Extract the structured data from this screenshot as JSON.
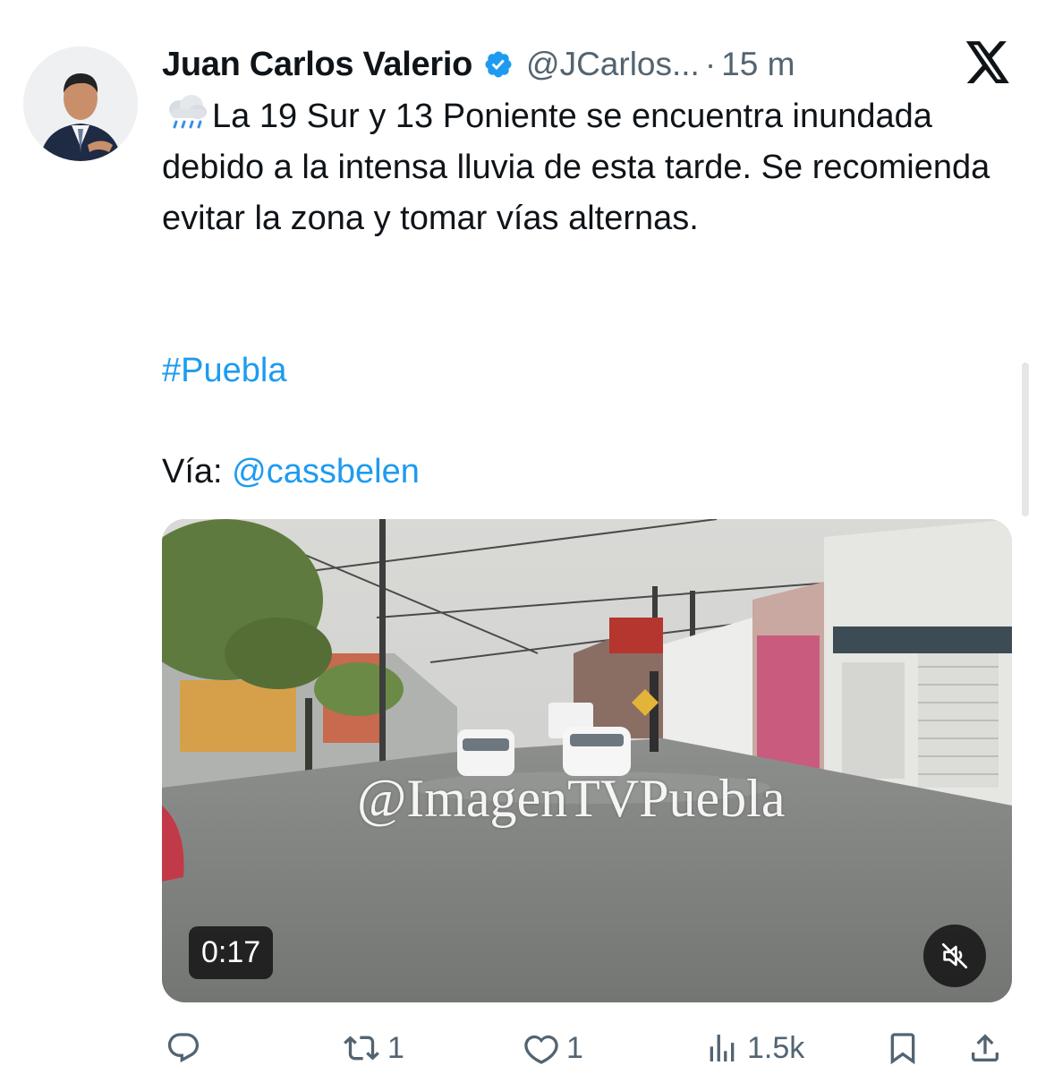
{
  "tweet": {
    "author_name": "Juan Carlos Valerio",
    "handle": "@JCarlos...",
    "separator": "·",
    "time": "15 m",
    "text": "La 19 Sur y 13 Poniente se encuentra inundada debido a la intensa lluvia de esta tarde. Se recomienda evitar la zona y tomar vías alternas.",
    "hashtag": "#Puebla",
    "via_label": "Vía:",
    "via_mention": "@cassbelen"
  },
  "media": {
    "watermark": "@ImagenTVPuebla",
    "duration": "0:17"
  },
  "actions": {
    "replies": "",
    "retweets": "1",
    "likes": "1",
    "views": "1.5k"
  },
  "icons": {
    "emoji": "cloud-with-rain-icon",
    "verified": "verified-badge-icon",
    "logo": "x-logo-icon",
    "mute": "muted-speaker-icon",
    "reply": "reply-icon",
    "retweet": "retweet-icon",
    "like": "heart-icon",
    "views": "views-icon",
    "bookmark": "bookmark-icon",
    "share": "share-icon"
  },
  "colors": {
    "link": "#1d9bf0",
    "text": "#0f1419",
    "secondary": "#536471"
  }
}
